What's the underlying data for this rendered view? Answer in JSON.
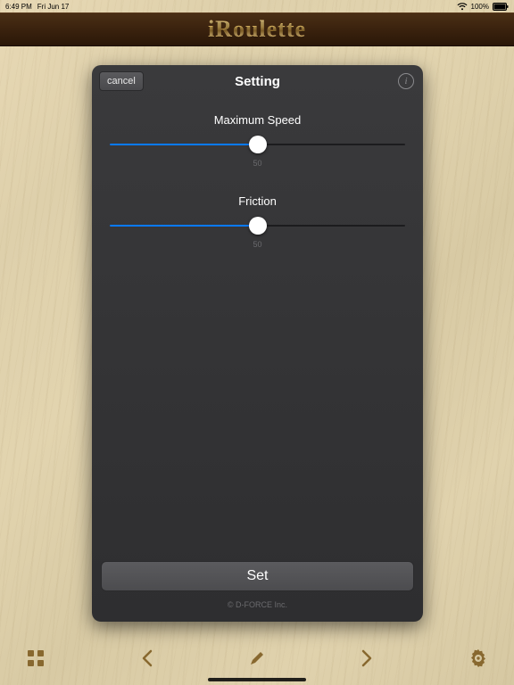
{
  "status": {
    "time": "6:49 PM",
    "date": "Fri Jun 17",
    "battery_pct": "100%"
  },
  "header": {
    "app_title": "iRoulette"
  },
  "panel": {
    "cancel_label": "cancel",
    "title": "Setting",
    "sliders": [
      {
        "label": "Maximum Speed",
        "value": 50,
        "display": "50",
        "percent": 50
      },
      {
        "label": "Friction",
        "value": 50,
        "display": "50",
        "percent": 50
      }
    ],
    "set_label": "Set",
    "copyright": "© D-FORCE Inc."
  },
  "colors": {
    "accent": "#0a7aff",
    "panel_bg": "#333335"
  }
}
